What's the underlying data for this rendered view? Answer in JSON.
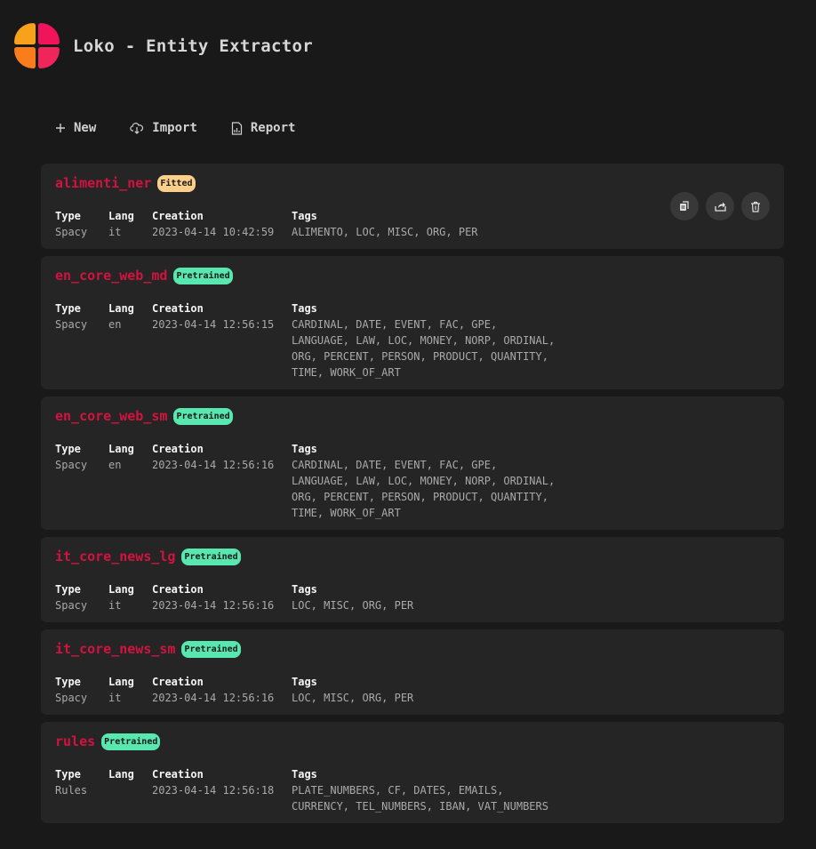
{
  "app": {
    "title": "Loko - Entity Extractor"
  },
  "toolbar": {
    "new_label": "New",
    "import_label": "Import",
    "report_label": "Report"
  },
  "columns": {
    "type": "Type",
    "lang": "Lang",
    "creation": "Creation",
    "tags": "Tags"
  },
  "colors": {
    "accent": "#d3133f",
    "badge_fitted": "#fbcf8a",
    "badge_pretrained": "#59e7b0",
    "background": "#191919",
    "card": "#252525"
  },
  "models": [
    {
      "name": "alimenti_ner",
      "status": "Fitted",
      "type": "Spacy",
      "lang": "it",
      "creation": "2023-04-14 10:42:59",
      "tags": "ALIMENTO, LOC, MISC, ORG, PER",
      "actions": [
        "copy-icon",
        "export-icon",
        "trash-icon"
      ]
    },
    {
      "name": "en_core_web_md",
      "status": "Pretrained",
      "type": "Spacy",
      "lang": "en",
      "creation": "2023-04-14 12:56:15",
      "tags": "CARDINAL, DATE, EVENT, FAC, GPE,\nLANGUAGE, LAW, LOC, MONEY, NORP, ORDINAL,\nORG, PERCENT, PERSON, PRODUCT, QUANTITY,\nTIME, WORK_OF_ART"
    },
    {
      "name": "en_core_web_sm",
      "status": "Pretrained",
      "type": "Spacy",
      "lang": "en",
      "creation": "2023-04-14 12:56:16",
      "tags": "CARDINAL, DATE, EVENT, FAC, GPE,\nLANGUAGE, LAW, LOC, MONEY, NORP, ORDINAL,\nORG, PERCENT, PERSON, PRODUCT, QUANTITY,\nTIME, WORK_OF_ART"
    },
    {
      "name": "it_core_news_lg",
      "status": "Pretrained",
      "type": "Spacy",
      "lang": "it",
      "creation": "2023-04-14 12:56:16",
      "tags": "LOC, MISC, ORG, PER"
    },
    {
      "name": "it_core_news_sm",
      "status": "Pretrained",
      "type": "Spacy",
      "lang": "it",
      "creation": "2023-04-14 12:56:16",
      "tags": "LOC, MISC, ORG, PER"
    },
    {
      "name": "rules",
      "status": "Pretrained",
      "type": "Rules",
      "lang": "",
      "creation": "2023-04-14 12:56:18",
      "tags": "PLATE_NUMBERS, CF, DATES, EMAILS,\nCURRENCY, TEL_NUMBERS, IBAN, VAT_NUMBERS"
    }
  ]
}
